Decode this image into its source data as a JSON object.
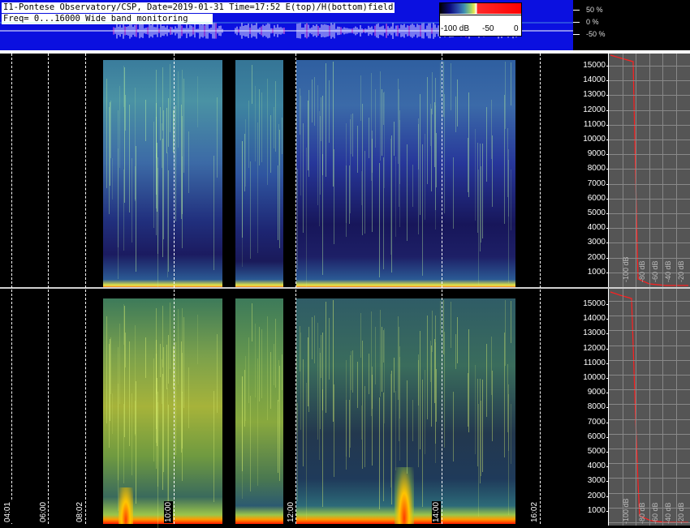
{
  "header": {
    "title_line1": "I1-Pontese Observatory/CSP, Date=2019-01-31 Time=17:52 E(top)/H(bottom)field",
    "title_line2": "Freq= 0...16000 Wide band monitoring"
  },
  "colorbar": {
    "labels": [
      "-100 dB",
      "-50",
      "0"
    ]
  },
  "waveform_scale": [
    "50 %",
    "0 %",
    "-50 %"
  ],
  "time_labels": [
    "04:01",
    "06:00",
    "08:02",
    "10:00",
    "12:00",
    "14:00",
    "16:02"
  ],
  "frequency_ticks": [
    "15000",
    "14000",
    "13000",
    "12000",
    "11000",
    "10000",
    "9000",
    "8000",
    "7000",
    "6000",
    "5000",
    "4000",
    "3000",
    "2000",
    "1000"
  ],
  "profile_db_labels": [
    "-100 dB",
    "-80 dB",
    "-60 dB",
    "-40 dB",
    "-20 dB"
  ],
  "panels": [
    {
      "name": "E-field (top)"
    },
    {
      "name": "H-field (bottom)"
    }
  ]
}
